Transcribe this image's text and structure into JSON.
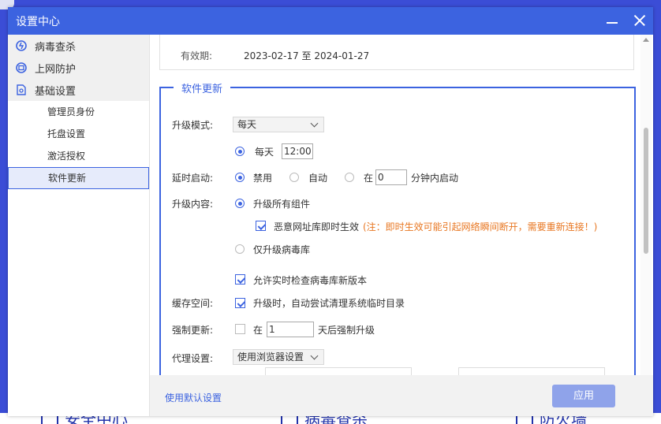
{
  "window": {
    "title": "设置中心"
  },
  "sidebar": {
    "items": [
      {
        "label": "病毒查杀",
        "icon": "virus-scan-icon"
      },
      {
        "label": "上网防护",
        "icon": "web-protection-icon"
      },
      {
        "label": "基础设置",
        "icon": "settings-document-icon"
      }
    ],
    "subitems": [
      {
        "label": "管理员身份"
      },
      {
        "label": "托盘设置"
      },
      {
        "label": "激活授权"
      },
      {
        "label": "软件更新",
        "active": true
      }
    ]
  },
  "license": {
    "label": "有效期:",
    "value": "2023-02-17 至 2024-01-27"
  },
  "update": {
    "legend": "软件更新",
    "mode": {
      "label": "升级模式:",
      "value": "每天"
    },
    "daily": {
      "label": "每天",
      "time": "12:00"
    },
    "delay": {
      "label": "延时启动:",
      "disable": "禁用",
      "auto": "自动",
      "at": "在",
      "minutes": "0",
      "suffix": "分钟内启动"
    },
    "content": {
      "label": "升级内容:",
      "all": "升级所有组件",
      "malicious": "恶意网址库即时生效",
      "warning": "(注：即时生效可能引起网络瞬间断开，需要重新连接！)",
      "virus_only": "仅升级病毒库"
    },
    "realtime_check": "允许实时检查病毒库新版本",
    "cache": {
      "label": "缓存空间:",
      "text": "升级时，自动尝试清理系统临时目录"
    },
    "force": {
      "label": "强制更新:",
      "at": "在",
      "days": "1",
      "suffix": "天后强制升级"
    },
    "proxy": {
      "label": "代理设置:",
      "value": "使用浏览器设置"
    }
  },
  "footer": {
    "default_link": "使用默认设置",
    "apply": "应用"
  },
  "background": {
    "items": [
      "安全中心",
      "病毒查杀",
      "防火墙"
    ]
  },
  "colors": {
    "accent": "#3c63e0",
    "titlebar": "#3c63e0",
    "apply_disabled": "#8fa3ea",
    "warning": "#e87722"
  }
}
